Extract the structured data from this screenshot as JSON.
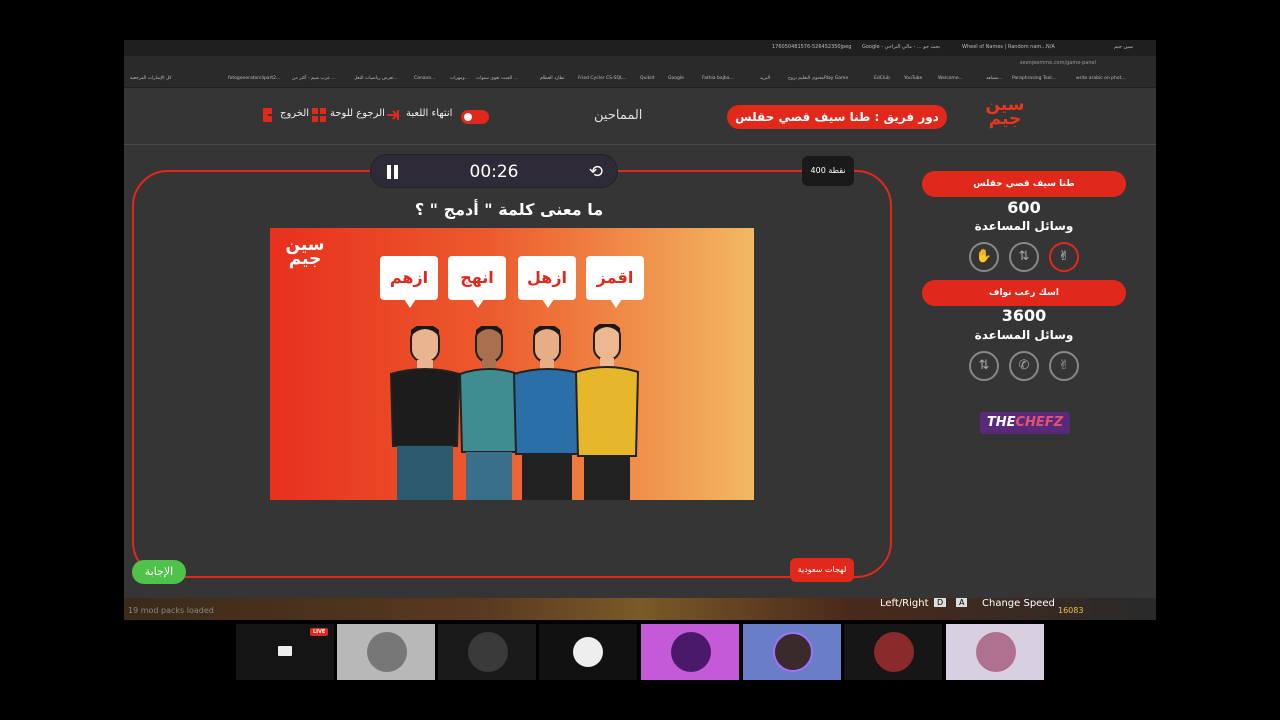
{
  "browser": {
    "tabs": [
      "176050481576-526452350jpeg",
      "Google - بحث جو ... - مالي التراخي",
      "Wheel of Names | Random nam...",
      "N/A",
      "سين جيم"
    ],
    "url": "seenjeemme.com/game-panel",
    "bookmarks": [
      "كل الإشارات المرجعية",
      "fotogeneratorclipart2...",
      "عرب شيم - أكثر من ...",
      "تعرض رياضيات التعل...",
      "Canava...",
      "ومهرات...",
      "الجبت تعوي سنوات ...",
      "تطارد العظام",
      "Fried Cycler CS-SQL...",
      "QuikId",
      "Google",
      "Fathia bajba...",
      "البريد",
      "محتوى التعليم نروح ...",
      "Play Game",
      "EdClub",
      "YouTube",
      "Welcome...",
      "مشاهد...",
      "Paraphrasing Tool...",
      "write arabic on phot..."
    ]
  },
  "header": {
    "logo": "سين جيم",
    "team_turn": "دور فريق : طنا سيف قصي حقلس",
    "tab_title": "المماحين",
    "end_game": "انتهاء اللعبة",
    "back_board": "الرجوع للوحة",
    "exit": "الخروج"
  },
  "game": {
    "timer": "00:26",
    "points": "400 نقطة",
    "question": "ما معنى كلمة \" أدمج \" ؟",
    "image_logo": "سين جيم",
    "options": [
      "اقمز",
      "ازهل",
      "انهج",
      "ازهم"
    ],
    "answer_button": "الإجابة",
    "category": "لهجات سعودية"
  },
  "teams": [
    {
      "name": "طنا سيف قصي حقلس",
      "score": "600",
      "helps_label": "وسائل المساعدة"
    },
    {
      "name": "اسك رعب نواف",
      "score": "3600",
      "helps_label": "وسائل المساعدة"
    }
  ],
  "sponsor": {
    "left": "THE",
    "right": "CHEFZ"
  },
  "game_strip": {
    "status": "19 mod packs loaded",
    "key_text": "Left/Right",
    "key_d": "D",
    "key_a": "A",
    "change_speed": "Change Speed",
    "coins": "16083"
  },
  "call": {
    "live": "LIVE"
  },
  "colors": {
    "accent": "#e0291b",
    "green": "#4fc24a",
    "panel": "#353535"
  }
}
